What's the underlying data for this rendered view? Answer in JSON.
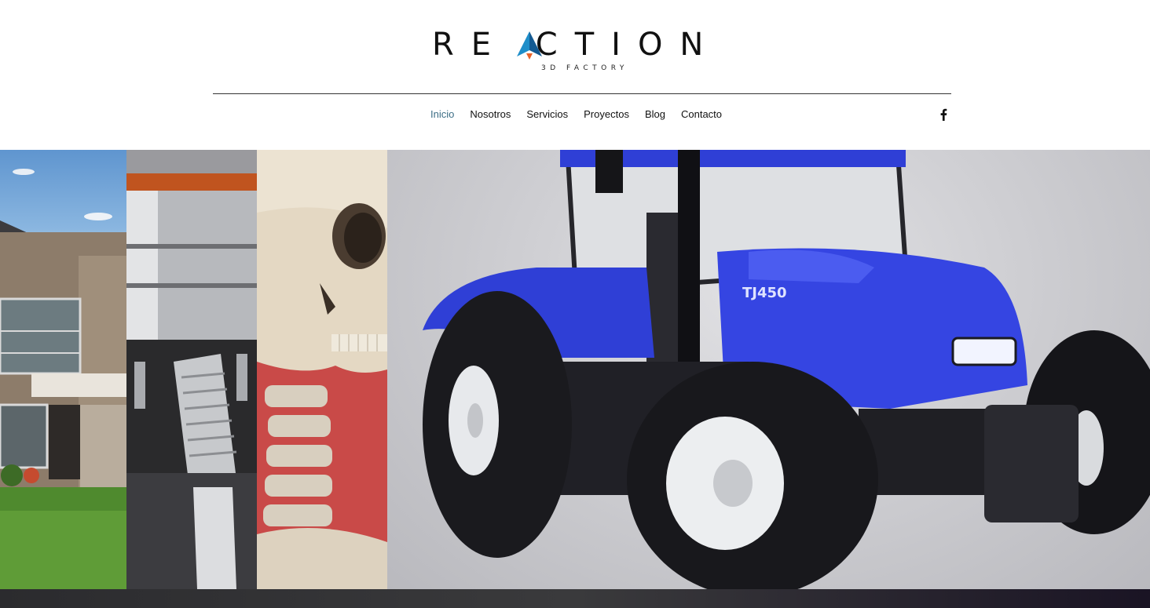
{
  "brand": {
    "name": "RE CTION",
    "tagline": "3D FACTORY",
    "accent": "#1f8ec9",
    "accent_dark": "#145a92",
    "accent_orange": "#e8632a",
    "logo_icon": "paper-plane-a-icon"
  },
  "nav": {
    "items": [
      {
        "label": "Inicio",
        "active": true
      },
      {
        "label": "Nosotros",
        "active": false
      },
      {
        "label": "Servicios",
        "active": false
      },
      {
        "label": "Proyectos",
        "active": false
      },
      {
        "label": "Blog",
        "active": false
      },
      {
        "label": "Contacto",
        "active": false
      }
    ],
    "active_color": "#3d6e86",
    "social_icon": "facebook-icon"
  },
  "hero": {
    "panels": [
      "house-render",
      "gear-cutaway-render",
      "skull-render",
      "tractor-render"
    ],
    "tractor_model": "TJ450",
    "tractor_color": "#2f3fd6"
  }
}
